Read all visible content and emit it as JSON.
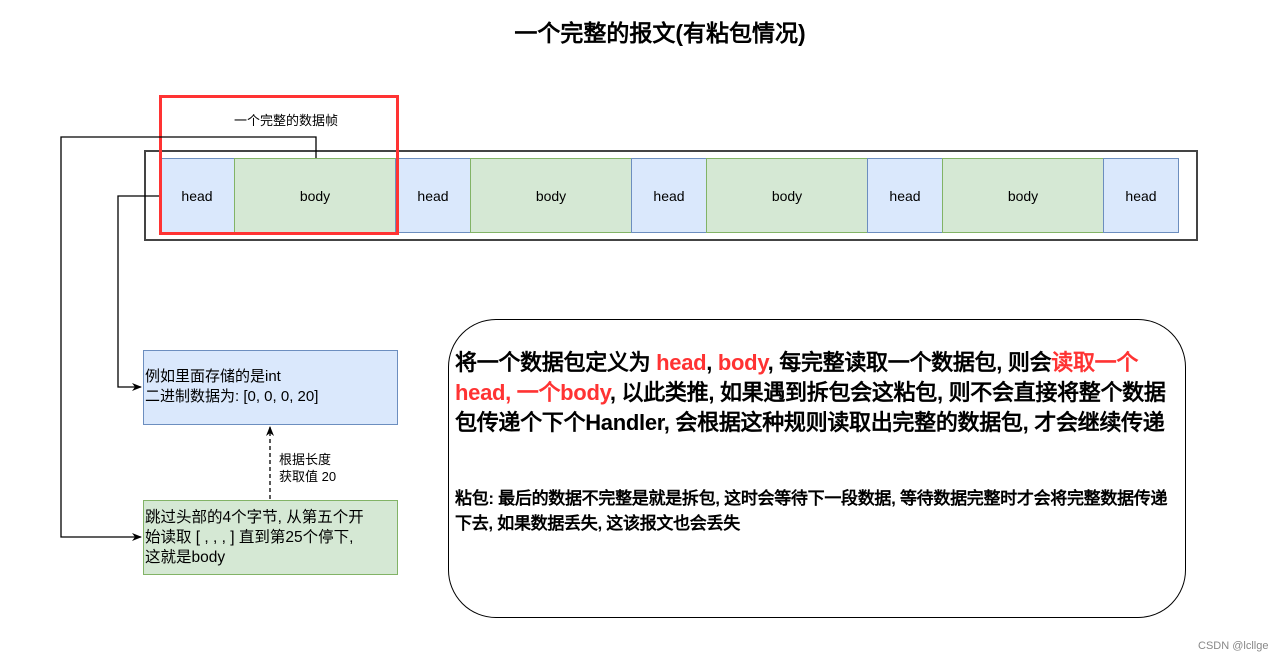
{
  "title": "一个完整的报文(有粘包情况)",
  "stream": {
    "segments": [
      {
        "type": "head",
        "label": "head"
      },
      {
        "type": "body",
        "label": "body"
      },
      {
        "type": "head",
        "label": "head"
      },
      {
        "type": "body",
        "label": "body"
      },
      {
        "type": "head",
        "label": "head"
      },
      {
        "type": "body",
        "label": "body"
      },
      {
        "type": "head",
        "label": "head"
      },
      {
        "type": "body",
        "label": "body"
      },
      {
        "type": "head",
        "label": "head"
      }
    ],
    "highlight_label": "一个完整的数据帧"
  },
  "int_box": {
    "line1": "例如里面存储的是int",
    "line2": "二进制数据为: [0, 0, 0, 20]"
  },
  "length_label": {
    "line1": "根据长度",
    "line2": "获取值 20"
  },
  "body_box": {
    "line1": "跳过头部的4个字节, 从第五个开",
    "line2": "始读取 [ , , , ] 直到第25个停下,",
    "line3": "这就是body"
  },
  "note": {
    "main": [
      {
        "text": "将一个数据包定义为 ",
        "red": false
      },
      {
        "text": "head",
        "red": true
      },
      {
        "text": ", ",
        "red": false
      },
      {
        "text": "body",
        "red": true
      },
      {
        "text": ", 每完整读取一个数据包, 则会",
        "red": false
      },
      {
        "text": "读取一个head, 一个body",
        "red": true
      },
      {
        "text": ", 以此类推, 如果遇到拆包会这粘包, 则不会直接将整个数据包传递个下个Handler, 会根据这种规则读取出完整的数据包, 才会继续传递",
        "red": false
      }
    ],
    "sub": "粘包: 最后的数据不完整是就是拆包, 这时会等待下一段数据, 等待数据完整时才会将完整数据传递下去, 如果数据丢失, 这该报文也会丢失"
  },
  "colors": {
    "head_fill": "#dae8fc",
    "head_stroke": "#6c8ebf",
    "body_fill": "#d5e8d4",
    "body_stroke": "#82b366",
    "highlight": "#ff3333",
    "emphasis_text": "#ff3333"
  },
  "watermark": "CSDN @lcllge"
}
